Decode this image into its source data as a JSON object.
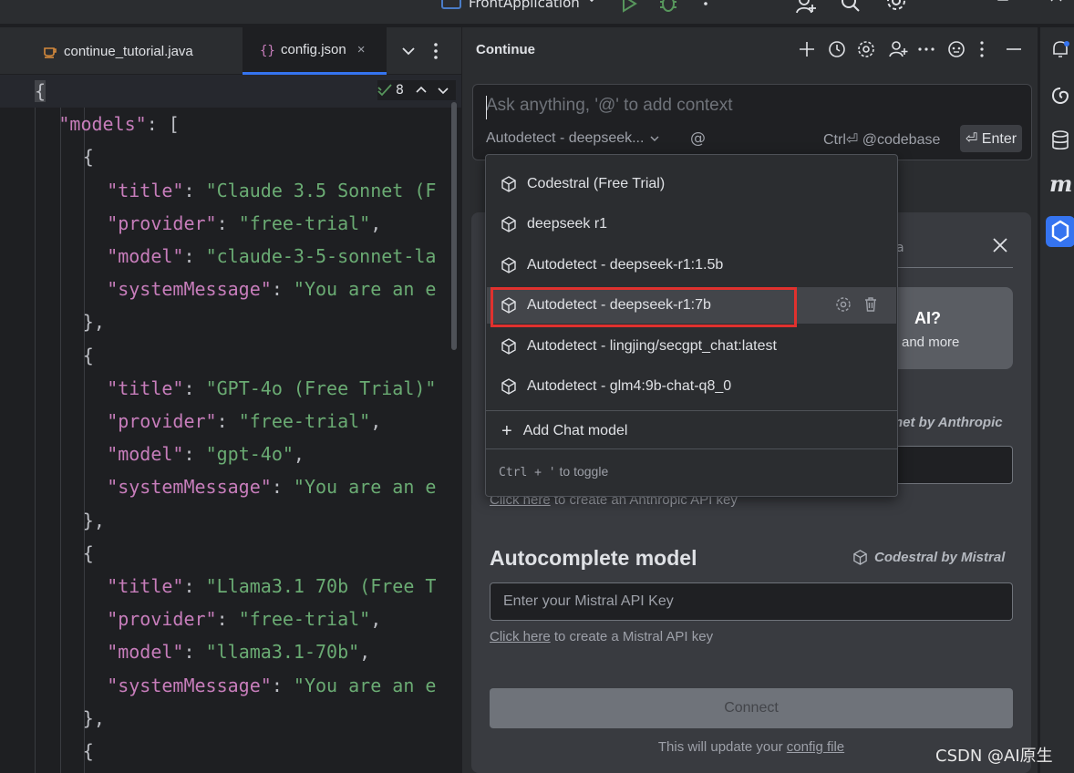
{
  "titlebar": {
    "project_name": "FrontApplication",
    "icons": [
      "project-icon",
      "chevron-down-icon",
      "run-icon",
      "debug-icon",
      "more-icon",
      "add-user-icon",
      "search-icon",
      "gear-icon",
      "minimize-icon",
      "maximize-icon",
      "close-icon"
    ]
  },
  "editor": {
    "tabs": [
      {
        "label": "continue_tutorial.java",
        "icon": "java-file-icon"
      },
      {
        "label": "config.json",
        "icon": "json-file-icon",
        "active": true,
        "close": "×"
      }
    ],
    "inspection_count": "8",
    "code": [
      {
        "indent": "",
        "parts": [
          [
            "p",
            "{"
          ]
        ]
      },
      {
        "indent": "  ",
        "parts": [
          [
            "k",
            "\"models\""
          ],
          [
            "p",
            ": ["
          ]
        ]
      },
      {
        "indent": "    ",
        "parts": [
          [
            "p",
            "{"
          ]
        ]
      },
      {
        "indent": "      ",
        "parts": [
          [
            "k",
            "\"title\""
          ],
          [
            "p",
            ": "
          ],
          [
            "s",
            "\"Claude 3.5 Sonnet (F"
          ]
        ]
      },
      {
        "indent": "      ",
        "parts": [
          [
            "k",
            "\"provider\""
          ],
          [
            "p",
            ": "
          ],
          [
            "s",
            "\"free-trial\""
          ],
          [
            "p",
            ","
          ]
        ]
      },
      {
        "indent": "      ",
        "parts": [
          [
            "k",
            "\"model\""
          ],
          [
            "p",
            ": "
          ],
          [
            "s",
            "\"claude-3-5-sonnet-la"
          ]
        ]
      },
      {
        "indent": "      ",
        "parts": [
          [
            "k",
            "\"systemMessage\""
          ],
          [
            "p",
            ": "
          ],
          [
            "s",
            "\"You are an e"
          ]
        ]
      },
      {
        "indent": "    ",
        "parts": [
          [
            "p",
            "},"
          ]
        ]
      },
      {
        "indent": "    ",
        "parts": [
          [
            "p",
            "{"
          ]
        ]
      },
      {
        "indent": "      ",
        "parts": [
          [
            "k",
            "\"title\""
          ],
          [
            "p",
            ": "
          ],
          [
            "s",
            "\"GPT-4o (Free Trial)\""
          ]
        ]
      },
      {
        "indent": "      ",
        "parts": [
          [
            "k",
            "\"provider\""
          ],
          [
            "p",
            ": "
          ],
          [
            "s",
            "\"free-trial\""
          ],
          [
            "p",
            ","
          ]
        ]
      },
      {
        "indent": "      ",
        "parts": [
          [
            "k",
            "\"model\""
          ],
          [
            "p",
            ": "
          ],
          [
            "s",
            "\"gpt-4o\""
          ],
          [
            "p",
            ","
          ]
        ]
      },
      {
        "indent": "      ",
        "parts": [
          [
            "k",
            "\"systemMessage\""
          ],
          [
            "p",
            ": "
          ],
          [
            "s",
            "\"You are an e"
          ]
        ]
      },
      {
        "indent": "    ",
        "parts": [
          [
            "p",
            "},"
          ]
        ]
      },
      {
        "indent": "    ",
        "parts": [
          [
            "p",
            "{"
          ]
        ]
      },
      {
        "indent": "      ",
        "parts": [
          [
            "k",
            "\"title\""
          ],
          [
            "p",
            ": "
          ],
          [
            "s",
            "\"Llama3.1 70b (Free T"
          ]
        ]
      },
      {
        "indent": "      ",
        "parts": [
          [
            "k",
            "\"provider\""
          ],
          [
            "p",
            ": "
          ],
          [
            "s",
            "\"free-trial\""
          ],
          [
            "p",
            ","
          ]
        ]
      },
      {
        "indent": "      ",
        "parts": [
          [
            "k",
            "\"model\""
          ],
          [
            "p",
            ": "
          ],
          [
            "s",
            "\"llama3.1-70b\""
          ],
          [
            "p",
            ","
          ]
        ]
      },
      {
        "indent": "      ",
        "parts": [
          [
            "k",
            "\"systemMessage\""
          ],
          [
            "p",
            ": "
          ],
          [
            "s",
            "\"You are an e"
          ]
        ]
      },
      {
        "indent": "    ",
        "parts": [
          [
            "p",
            "},"
          ]
        ]
      },
      {
        "indent": "    ",
        "parts": [
          [
            "p",
            "{"
          ]
        ]
      }
    ]
  },
  "continue": {
    "title": "Continue",
    "header_icons": [
      "add-icon",
      "history-icon",
      "gear-icon",
      "add-user-icon",
      "more-horizontal-icon",
      "emoji-icon",
      "more-vertical-icon",
      "minimize-icon"
    ],
    "input": {
      "placeholder": "Ask anything, '@' to add context",
      "model_label": "Autodetect - deepseek...",
      "at_symbol": "@",
      "codebase_hint": "Ctrl⏎ @codebase",
      "enter_label": "⏎ Enter"
    },
    "dropdown": {
      "items": [
        {
          "label": "Codestral (Free Trial)"
        },
        {
          "label": "deepseek r1"
        },
        {
          "label": "Autodetect - deepseek-r1:1.5b"
        },
        {
          "label": "Autodetect - deepseek-r1:7b",
          "active": true
        },
        {
          "label": "Autodetect - lingjing/secgpt_chat:latest"
        },
        {
          "label": "Autodetect - glm4:9b-chat-q8_0"
        }
      ],
      "add_model": "Add Chat model",
      "footer_key": "Ctrl + '",
      "footer_text": "to toggle"
    },
    "onboarding": {
      "tab_tail": "a",
      "promo_title": "AI?",
      "promo_sub": "and more",
      "chat_provider_tail": "net by Anthropic",
      "anthropic_link": "Click here",
      "anthropic_link_tail": "to create an Anthropic API key",
      "autocomplete_title": "Autocomplete model",
      "autocomplete_provider": "Codestral by Mistral",
      "mistral_placeholder": "Enter your Mistral API Key",
      "mistral_link": "Click here",
      "mistral_link_tail": "to create a Mistral API key",
      "connect_label": "Connect",
      "config_note": "This will update your",
      "config_link": "config file"
    }
  },
  "tool_strip": {
    "icons": [
      "notifications-icon",
      "ai-assistant-icon",
      "database-icon",
      "markdown-m-icon",
      "continue-icon"
    ],
    "markdown_glyph": "m"
  },
  "watermark": "CSDN @AI原生"
}
